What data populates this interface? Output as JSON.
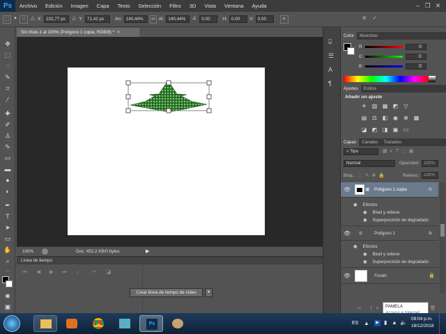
{
  "app": {
    "logo": "Ps"
  },
  "menu": [
    "Archivo",
    "Edición",
    "Imagen",
    "Capa",
    "Texto",
    "Selección",
    "Filtro",
    "3D",
    "Vista",
    "Ventana",
    "Ayuda"
  ],
  "options": {
    "x_label": "X:",
    "x_value": "232,77 px",
    "y_label": "Y:",
    "y_value": "71,42 px",
    "w_label": "An:",
    "w_value": "140,44%",
    "h_label": "Al:",
    "h_value": "140,44%",
    "angle": "0,00",
    "hskew_label": "H:",
    "hskew": "0,00",
    "vskew_label": "V:",
    "vskew": "0,00"
  },
  "document": {
    "tab_title": "Sin título-1 al 100% (Polígono 1 copia, RGB/8) *",
    "zoom": "100%",
    "doc_info": "Doc: 452,2 KB/0 bytes"
  },
  "timeline": {
    "title": "Línea de tiempo",
    "create_button": "Crear línea de tiempo de vídeo"
  },
  "color_panel": {
    "tabs": [
      "Color",
      "Muestras"
    ],
    "channels": [
      {
        "label": "R",
        "value": "0"
      },
      {
        "label": "G",
        "value": "0"
      },
      {
        "label": "B",
        "value": "0"
      }
    ],
    "foreground": "#000000",
    "background": "#ffffff"
  },
  "adjust_panel": {
    "tabs": [
      "Ajustes",
      "Estilos"
    ],
    "title": "Añadir un ajuste"
  },
  "layers_panel": {
    "tabs": [
      "Capas",
      "Canales",
      "Trazados"
    ],
    "filter_label": "Tipo",
    "blend_mode": "Normal",
    "opacity_label": "Opacidad:",
    "opacity_value": "100%",
    "lock_label": "Bloq.:",
    "fill_label": "Relleno:",
    "fill_value": "100%",
    "layers": [
      {
        "name": "Polígono 1 copia",
        "fx": "fx",
        "effects_label": "Efectos",
        "effects": [
          "Bisel y relieve",
          "Superposición de degradado"
        ]
      },
      {
        "name": "Polígono 1",
        "fx": "fx",
        "effects_label": "Efectos",
        "effects": [
          "Bisel y relieve",
          "Superposición de degradado"
        ]
      },
      {
        "name": "Fondo"
      }
    ]
  },
  "tooltip": {
    "title": "PAMELA",
    "subtitle": "Acceso a Internet"
  },
  "taskbar": {
    "language": "ES",
    "time": "09:04 p.m.",
    "date": "18/12/2018"
  }
}
